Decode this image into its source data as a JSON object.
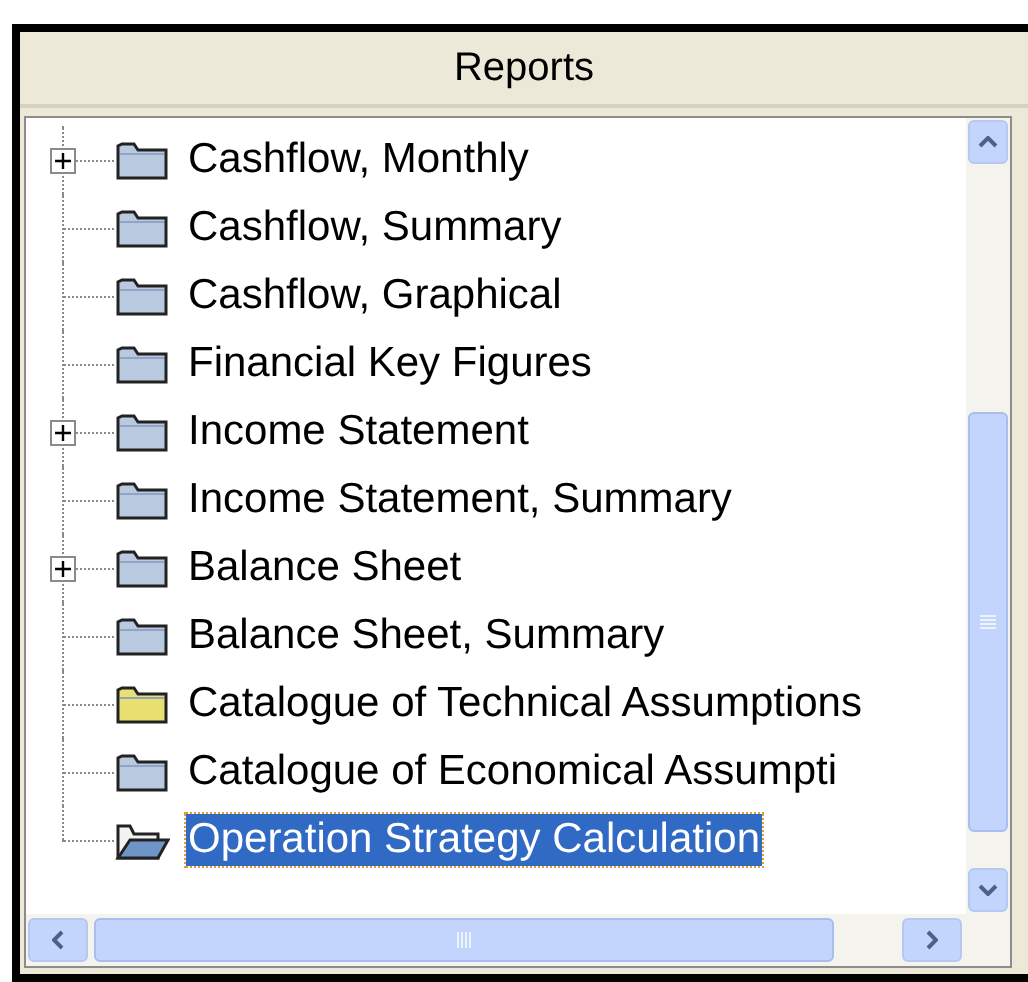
{
  "panel": {
    "title": "Reports"
  },
  "tree": {
    "items": [
      {
        "label": "Cashflow, Monthly",
        "expandable": true,
        "kind": "folder",
        "color": "#b9c9e0",
        "selected": false
      },
      {
        "label": "Cashflow, Summary",
        "expandable": false,
        "kind": "folder",
        "color": "#b9c9e0",
        "selected": false
      },
      {
        "label": "Cashflow, Graphical",
        "expandable": false,
        "kind": "folder",
        "color": "#b9c9e0",
        "selected": false
      },
      {
        "label": "Financial Key Figures",
        "expandable": false,
        "kind": "folder",
        "color": "#b9c9e0",
        "selected": false
      },
      {
        "label": "Income Statement",
        "expandable": true,
        "kind": "folder",
        "color": "#b9c9e0",
        "selected": false
      },
      {
        "label": "Income Statement, Summary",
        "expandable": false,
        "kind": "folder",
        "color": "#b9c9e0",
        "selected": false
      },
      {
        "label": "Balance Sheet",
        "expandable": true,
        "kind": "folder",
        "color": "#b9c9e0",
        "selected": false
      },
      {
        "label": "Balance Sheet, Summary",
        "expandable": false,
        "kind": "folder",
        "color": "#b9c9e0",
        "selected": false
      },
      {
        "label": "Catalogue of Technical Assumptions",
        "expandable": false,
        "kind": "folder",
        "color": "#e8e070",
        "selected": false
      },
      {
        "label": "Catalogue of Economical Assumpti",
        "expandable": false,
        "kind": "folder",
        "color": "#b9c9e0",
        "selected": false
      },
      {
        "label": "Operation Strategy Calculation",
        "expandable": false,
        "kind": "open-folder",
        "color": "#6f95c8",
        "selected": true
      }
    ]
  }
}
